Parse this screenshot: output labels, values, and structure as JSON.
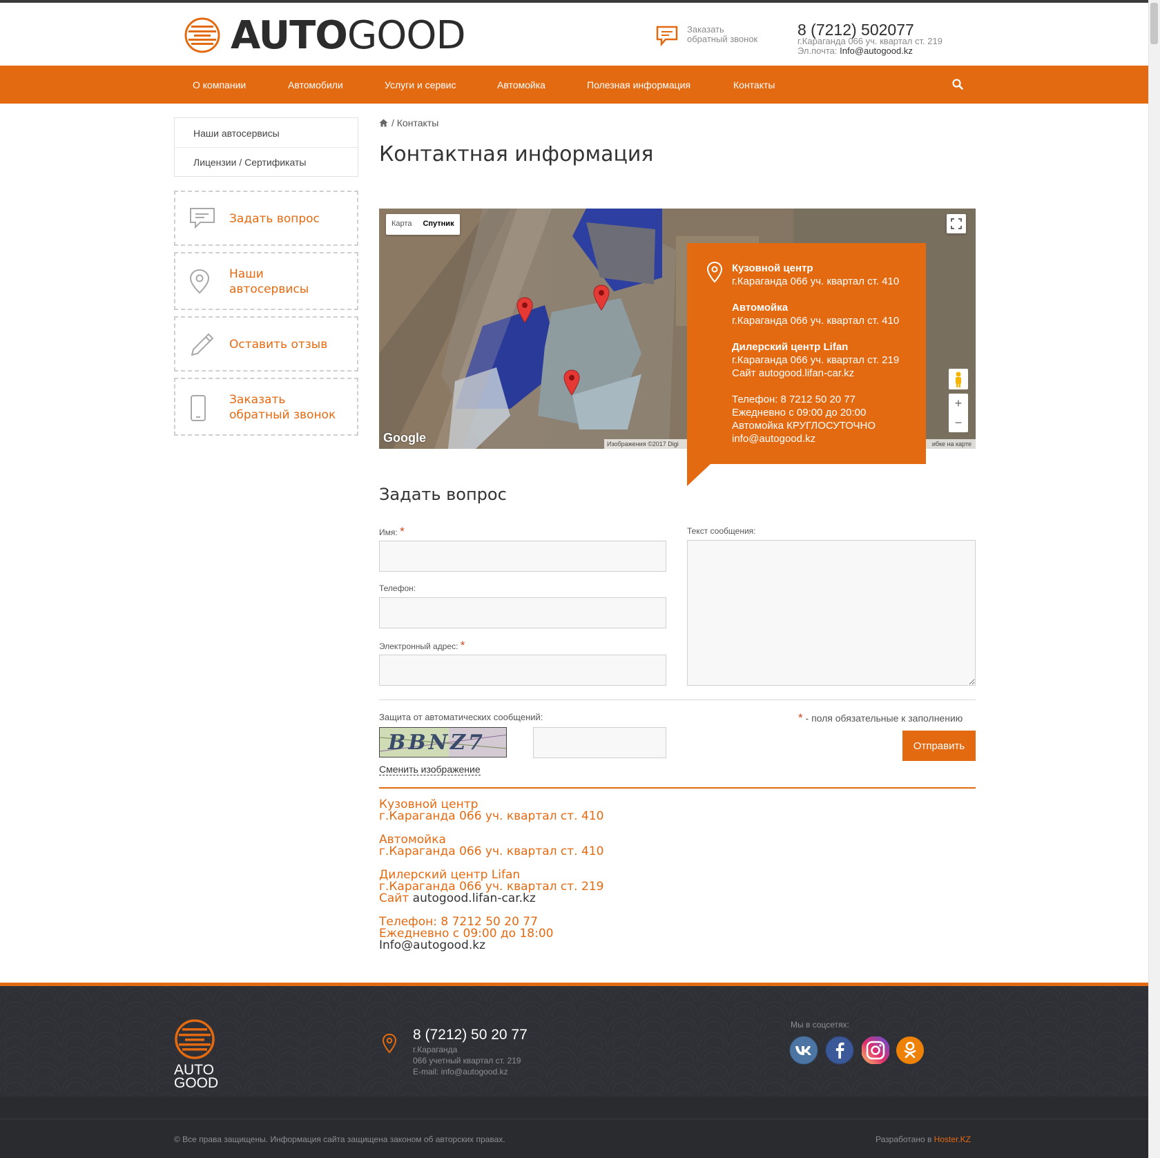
{
  "header": {
    "logo_auto": "AUTO",
    "logo_good": "GOOD",
    "callback_line1": "Заказать",
    "callback_line2": "обратный звонок",
    "phone": "8 (7212) 502077",
    "address": "г.Караганда 066 уч. квартал ст. 219",
    "email_label": "Эл.почта: ",
    "email": "Info@autogood.kz"
  },
  "nav": {
    "items": [
      "О компании",
      "Автомобили",
      "Услуги и сервис",
      "Автомойка",
      "Полезная информация",
      "Контакты"
    ]
  },
  "sidebar": {
    "menu": [
      "Наши автосервисы",
      "Лицензии / Сертификаты"
    ],
    "boxes": [
      {
        "line1": "Задать вопрос",
        "line2": "",
        "icon": "chat-icon"
      },
      {
        "line1": "Наши",
        "line2": "автосервисы",
        "icon": "location-pin-icon"
      },
      {
        "line1": "Оставить отзыв",
        "line2": "",
        "icon": "pencil-icon"
      },
      {
        "line1": "Заказать",
        "line2": "обратный звонок",
        "icon": "mobile-phone-icon"
      }
    ]
  },
  "breadcrumb": {
    "current": "Контакты"
  },
  "page_title": "Контактная информация",
  "map": {
    "type_map": "Карта",
    "type_satellite": "Спутник",
    "zoom_in": "+",
    "zoom_out": "−",
    "google": "Google",
    "attribution": "Изображения ©2017 Digi",
    "report": "ибке на карте"
  },
  "info_card": {
    "c1_name": "Кузовной центр",
    "c1_addr": "г.Караганда 066 уч. квартал ст. 410",
    "c2_name": "Автомойка",
    "c2_addr": "г.Караганда 066 уч. квартал ст. 410",
    "c3_name": "Дилерский центр Lifan",
    "c3_addr": "г.Караганда 066 уч. квартал ст. 219",
    "site_label": "Сайт ",
    "site": "autogood.lifan-car.kz",
    "phone": "Телефон: 8 7212 50 20 77",
    "hours": "Ежедневно с 09:00 до 20:00",
    "wash": "Автомойка КРУГЛОСУТОЧНО",
    "email": "info@autogood.kz"
  },
  "form": {
    "title": "Задать вопрос",
    "name_label": "Имя:",
    "phone_label": "Телефон:",
    "email_label": "Электронный адрес:",
    "message_label": "Текст сообщения:",
    "captcha_label": "Защита от автоматических сообщений:",
    "captcha_text": "BBNZ7",
    "change_image": "Сменить изображение",
    "required_note": " - поля обязательные к заполнению",
    "required_star": "*",
    "submit": "Отправить"
  },
  "contacts_block": {
    "c1_name": "Кузовной центр",
    "c1_addr": "г.Караганда 066 уч. квартал ст. 410",
    "c2_name": "Автомойка",
    "c2_addr": "г.Караганда 066 уч. квартал ст. 410",
    "c3_name": "Дилерский центр Lifan",
    "c3_addr": "г.Караганда 066 уч. квартал ст. 219",
    "site_label": "Сайт ",
    "site": "autogood.lifan-car.kz",
    "phone": "Телефон: 8 7212 50 20 77",
    "hours": "Ежедневно с 09:00 до 18:00",
    "email": "Info@autogood.kz"
  },
  "footer": {
    "logo_auto": "AUTO",
    "logo_good": "GOOD",
    "phone": "8 (7212) 50 20 77",
    "city": "г.Караганда",
    "address": "066 учетный квартал ст. 219",
    "email": "E-mail: info@autogood.kz",
    "social_label": "Мы в соцсетях:",
    "social": [
      {
        "name": "vk-icon",
        "color": "#4c75a3"
      },
      {
        "name": "facebook-icon",
        "color": "#3b5998"
      },
      {
        "name": "instagram-icon",
        "color": "#c13584"
      },
      {
        "name": "odnoklassniki-icon",
        "color": "#ee8208"
      }
    ],
    "copyright": "© Все права защищены. Информация сайта защищена законом об авторских правах.",
    "developer_label": "Разработано в ",
    "developer": "Hoster.KZ"
  },
  "colors": {
    "accent": "#e46a12",
    "footer_bg": "#2f3035"
  }
}
